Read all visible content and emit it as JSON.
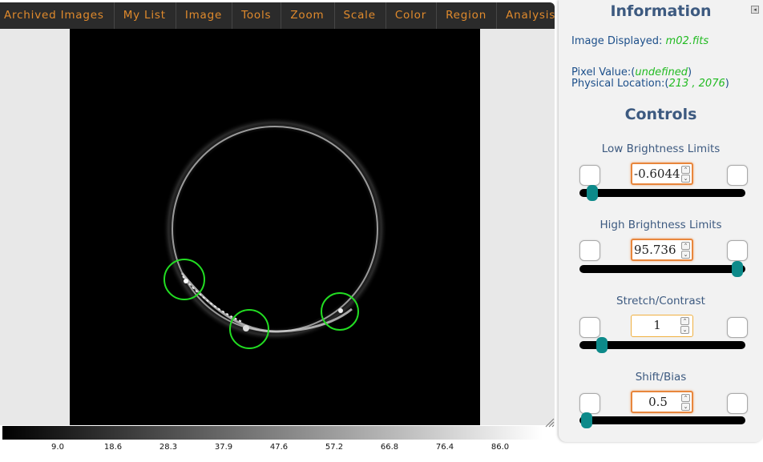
{
  "menu": [
    {
      "label": "Archived Images"
    },
    {
      "label": "My List"
    },
    {
      "label": "Image"
    },
    {
      "label": "Tools"
    },
    {
      "label": "Zoom"
    },
    {
      "label": "Scale"
    },
    {
      "label": "Color"
    },
    {
      "label": "Region"
    },
    {
      "label": "Analysis"
    }
  ],
  "colorbar": {
    "ticks": [
      "9.0",
      "18.6",
      "28.3",
      "37.9",
      "47.6",
      "57.2",
      "66.8",
      "76.4",
      "86.0"
    ]
  },
  "info": {
    "title": "Information",
    "image_label": "Image Displayed: ",
    "image_name": "m02.fits",
    "pixel_label": "Pixel Value:(",
    "pixel_value": "undefined",
    "pixel_close": ")",
    "location_label": "Physical Location:(",
    "location_value": "213 , 2076",
    "location_close": ")"
  },
  "controls": {
    "title": "Controls",
    "low": {
      "label": "Low Brightness Limits",
      "value": "-0.6044",
      "slider_fraction": 0.0
    },
    "high": {
      "label": "High Brightness Limits",
      "value": "95.736",
      "slider_fraction": 1.0
    },
    "stretch": {
      "label": "Stretch/Contrast",
      "value": "1",
      "slider_fraction": 0.07
    },
    "shift": {
      "label": "Shift/Bias",
      "value": "0.5",
      "slider_fraction": 0.0
    }
  },
  "colors": {
    "menu_text": "#e08a2c",
    "region_circle": "#22dd22",
    "panel_heading": "#3d5a80",
    "value_green": "#22bb22",
    "slider_handle": "#0d8a8a"
  }
}
